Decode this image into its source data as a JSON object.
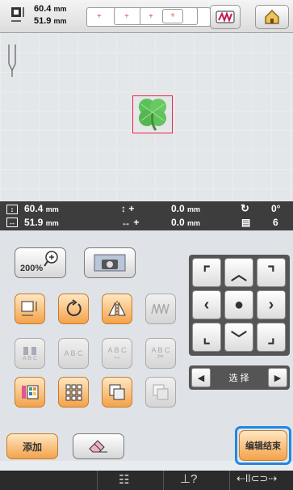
{
  "top": {
    "width": {
      "value": "60.4",
      "unit": "mm"
    },
    "height": {
      "value": "51.9",
      "unit": "mm"
    },
    "frame_symbols": [
      "+",
      "+",
      "+",
      "+"
    ]
  },
  "status": {
    "size_h": {
      "value": "60.4",
      "unit": "mm"
    },
    "size_w": {
      "value": "51.9",
      "unit": "mm"
    },
    "offset_y": {
      "value": "0.0",
      "unit": "mm"
    },
    "offset_x": {
      "value": "0.0",
      "unit": "mm"
    },
    "rotation": "0°",
    "color_count": "6",
    "sign_plus": "+"
  },
  "controls": {
    "zoom_label": "200%",
    "abc_labels": [
      "A B C",
      "A B C",
      "A B C",
      "A B C"
    ],
    "select_label": "选 择"
  },
  "footer": {
    "add_label": "添加",
    "finish_label": "编辑结束"
  },
  "colors": {
    "accent": "#1e88e5",
    "design_green": "#5cc05a",
    "frame_red": "#e24444",
    "status_bg": "#3d3d3d"
  }
}
